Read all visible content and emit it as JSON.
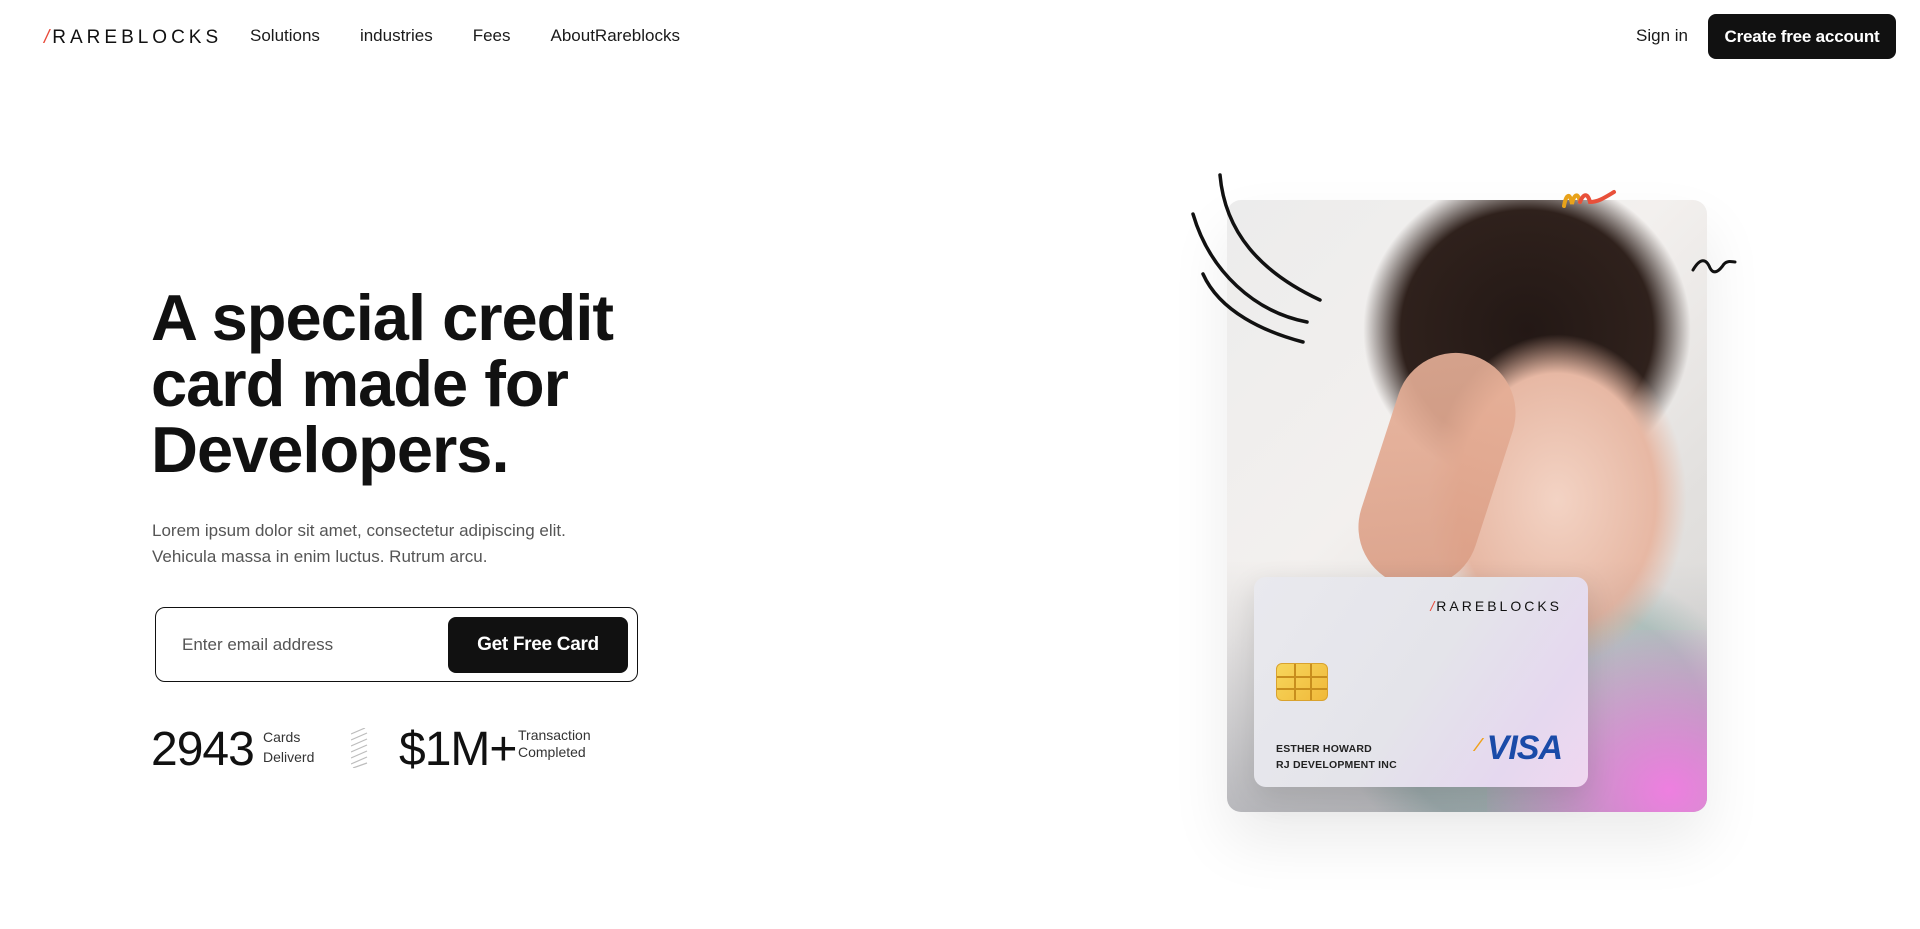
{
  "nav": {
    "logo_slash": "/",
    "logo_text": "RAREBLOCKS",
    "links": [
      "Solutions",
      "industries",
      "Fees",
      "AboutRareblocks"
    ],
    "sign_in": "Sign in",
    "create_account": "Create free account"
  },
  "hero": {
    "title": "A special credit card made for Developers.",
    "description": "Lorem ipsum dolor sit amet, consectetur adipiscing elit. Vehicula massa in enim luctus. Rutrum arcu.",
    "email_placeholder": "Enter email address",
    "cta": "Get Free Card",
    "stats": [
      {
        "value": "2943",
        "label_line1": "Cards",
        "label_line2": "Deliverd"
      },
      {
        "value": "$1M+",
        "label_line1": "Transaction",
        "label_line2": "Completed"
      }
    ]
  },
  "card": {
    "logo_slash": "/",
    "logo_text": "RAREBLOCKS",
    "holder_name": "ESTHER HOWARD",
    "holder_company": "RJ DEVELOPMENT INC",
    "network": "VISA"
  },
  "colors": {
    "accent": "#e84a3a",
    "dark": "#111111",
    "visa_blue": "#1a4ba8",
    "card_pink": "#ee7fe0"
  },
  "icons": [
    "chip-icon",
    "visa-logo",
    "scribble-decoration"
  ]
}
